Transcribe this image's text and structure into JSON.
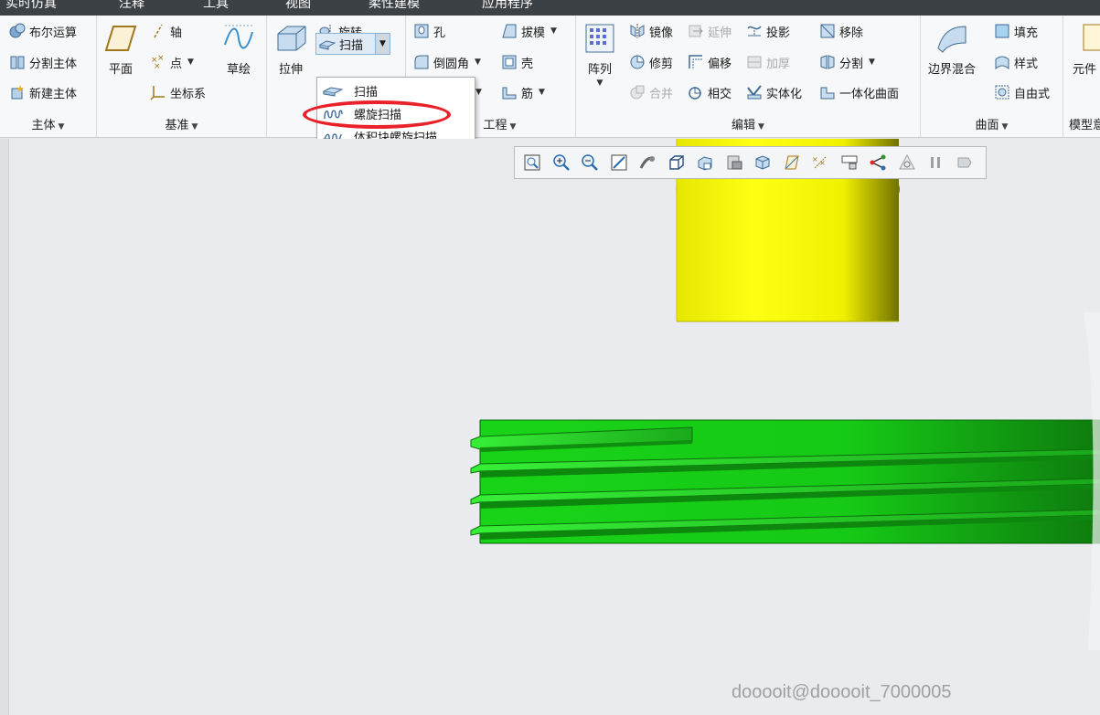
{
  "menubar": {
    "items": [
      "实时仿真",
      "注释",
      "工具",
      "视图",
      "柔性建模",
      "应用程序"
    ]
  },
  "groups": {
    "body": {
      "label": "主体",
      "items": [
        "布尔运算",
        "分割主体",
        "新建主体"
      ]
    },
    "datum": {
      "label": "基准",
      "plane": "平面",
      "axis": "轴",
      "point": "点",
      "csys": "坐标系",
      "sketch": "草绘"
    },
    "shapes": {
      "extrude": "拉伸",
      "revolve": "旋转",
      "sweep": "扫描"
    },
    "engineering": {
      "label": "工程",
      "hole": "孔",
      "round": "倒圆角",
      "draft": "拔模",
      "shell": "壳",
      "rib": "筋"
    },
    "editing": {
      "label": "编辑",
      "pattern": "阵列",
      "mirror": "镜像",
      "extend": "延伸",
      "project": "投影",
      "trim": "修剪",
      "offset": "偏移",
      "thicken": "加厚",
      "merge": "合并",
      "intersect": "相交",
      "solidify": "实体化",
      "remove": "移除",
      "split": "分割",
      "unify_surface": "一体化曲面"
    },
    "surfaces": {
      "label": "曲面",
      "boundary_blend": "边界混合",
      "fill": "填充",
      "style": "样式",
      "freestyle": "自由式"
    },
    "model_intent": {
      "label": "模型意",
      "component": "元件"
    }
  },
  "sweep_menu": {
    "items": [
      "扫描",
      "螺旋扫描",
      "体积块螺旋扫描"
    ],
    "highlighted": "螺旋扫描"
  },
  "view_toolbar": {
    "icons": [
      "zoom-refit-icon",
      "zoom-in-icon",
      "zoom-out-icon",
      "repaint-icon",
      "spin-center-icon",
      "display-style-icon",
      "saved-orientations-icon",
      "view-manager-icon",
      "perspective-icon",
      "datum-display-icon",
      "annotation-display-icon",
      "model-tree-icon",
      "section-icon",
      "simulation-icon",
      "pause-icon",
      "next-icon"
    ]
  },
  "colors": {
    "yellow_body": "#f2f200",
    "green_body": "#1ec41e",
    "highlight": "#e8212a"
  },
  "watermark": "dooooit@dooooit_7000005"
}
